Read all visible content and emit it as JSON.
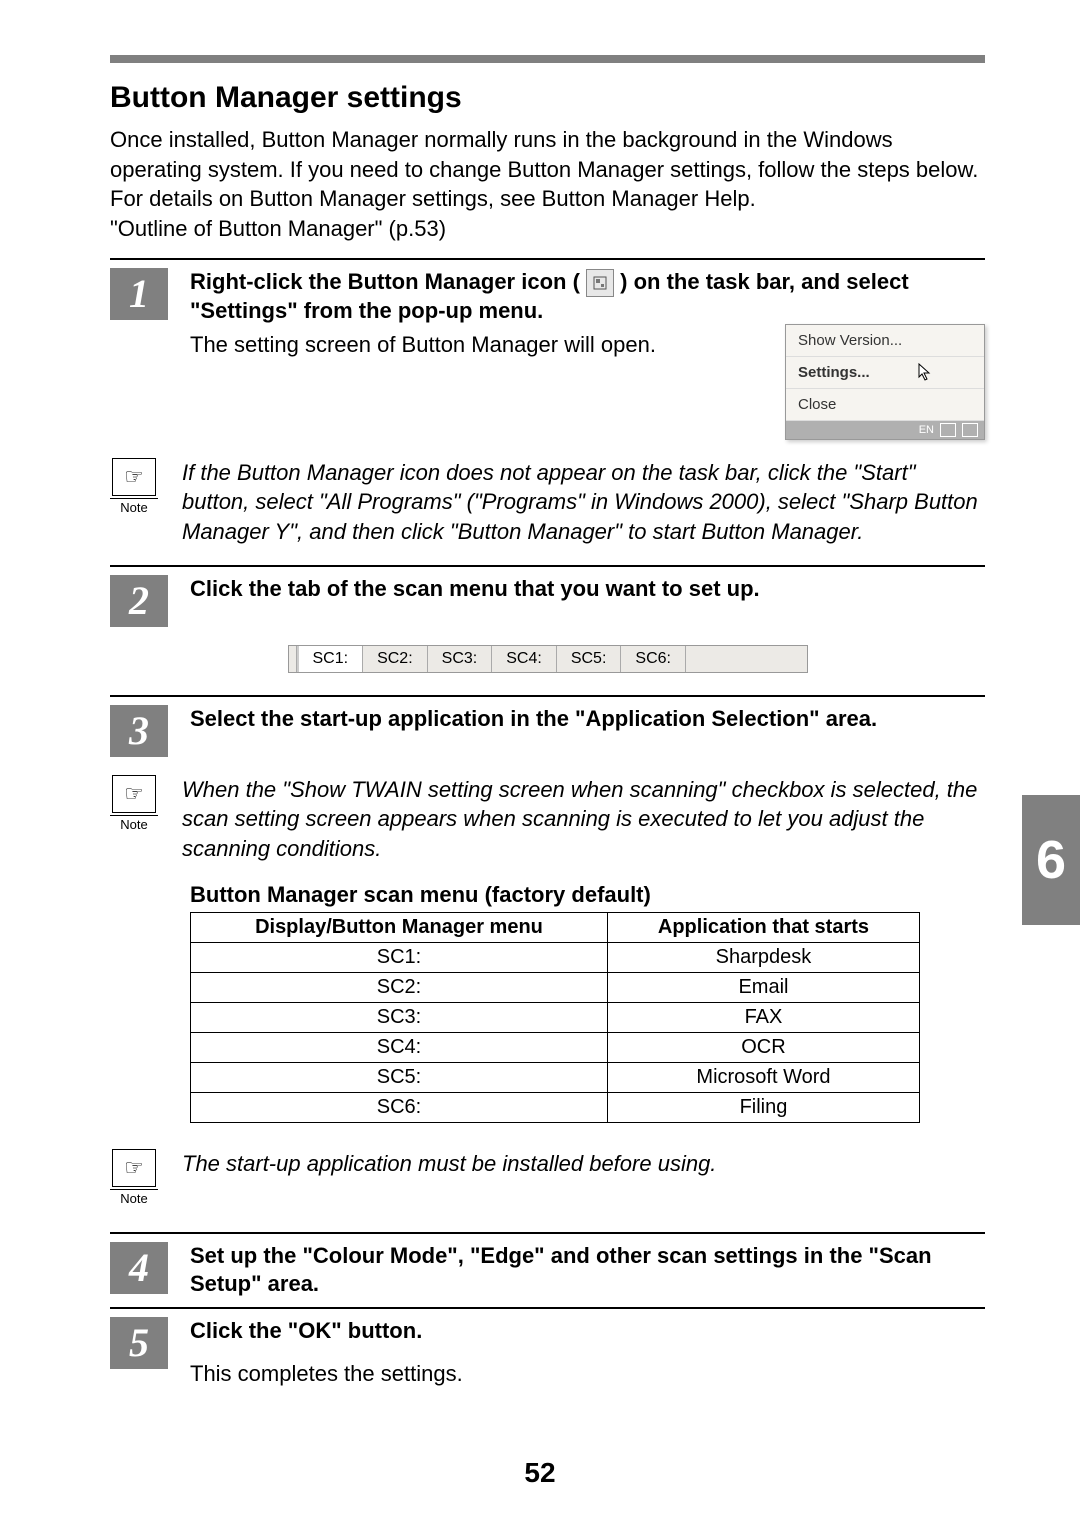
{
  "page": {
    "title": "Button Manager settings",
    "intro": "Once installed, Button Manager normally runs in the background in the Windows operating system. If you need to change Button Manager settings, follow the steps below. For details on Button Manager settings, see Button Manager Help.\n\"Outline of Button Manager\" (p.53)",
    "chapter_tab": "6",
    "page_number": "52"
  },
  "steps": {
    "s1": {
      "num": "1",
      "title_a": "Right-click the Button Manager icon (",
      "title_b": ") on the task bar, and select \"Settings\" from the pop-up menu.",
      "desc": "The setting screen of Button Manager will open."
    },
    "s2": {
      "num": "2",
      "title": "Click the tab of the scan menu that you want to set up."
    },
    "s3": {
      "num": "3",
      "title": "Select the start-up application in the \"Application Selection\" area."
    },
    "s4": {
      "num": "4",
      "title": "Set up the \"Colour Mode\", \"Edge\" and other scan settings in the \"Scan Setup\" area."
    },
    "s5": {
      "num": "5",
      "title": "Click the \"OK\" button.",
      "desc": "This completes the settings."
    }
  },
  "menu": {
    "show_version": "Show Version...",
    "settings": "Settings...",
    "close": "Close",
    "tray_lang": "EN"
  },
  "tabs": {
    "t1": "SC1:",
    "t2": "SC2:",
    "t3": "SC3:",
    "t4": "SC4:",
    "t5": "SC5:",
    "t6": "SC6:"
  },
  "notes": {
    "label": "Note",
    "n1": "If the Button Manager icon does not appear on the task bar, click the \"Start\" button, select \"All Programs\" (\"Programs\" in Windows 2000), select \"Sharp Button Manager Y\", and then click \"Button Manager\" to start Button Manager.",
    "n2": "When the \"Show TWAIN setting screen when scanning\" checkbox is selected, the scan setting screen appears when scanning is executed to let you adjust the scanning conditions.",
    "n3": "The start-up application must be installed before using."
  },
  "table": {
    "caption": "Button Manager scan menu (factory default)",
    "h1": "Display/Button Manager menu",
    "h2": "Application that starts",
    "rows": [
      {
        "menu": "SC1:",
        "app": "Sharpdesk"
      },
      {
        "menu": "SC2:",
        "app": "Email"
      },
      {
        "menu": "SC3:",
        "app": "FAX"
      },
      {
        "menu": "SC4:",
        "app": "OCR"
      },
      {
        "menu": "SC5:",
        "app": "Microsoft Word"
      },
      {
        "menu": "SC6:",
        "app": "Filing"
      }
    ]
  }
}
